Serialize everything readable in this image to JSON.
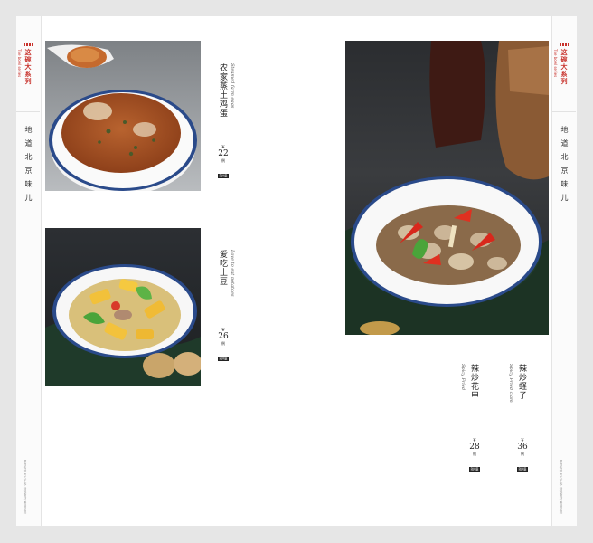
{
  "series": {
    "title": "这碗大系列",
    "subtitle": "The bowl series"
  },
  "region": "地道北京味儿",
  "footer": "源自传统 匠心之作 精选食材 美味呈现",
  "dishes": [
    {
      "cn": "农家蒸土鸡蛋",
      "en": "Steamed farm eggs",
      "currency": "¥",
      "price": "22",
      "unit": "例",
      "rmb": "RMB"
    },
    {
      "cn": "爱吃土豆",
      "en": "Love to eat potatoes",
      "currency": "¥",
      "price": "26",
      "unit": "例",
      "rmb": "RMB"
    },
    {
      "cn": "辣炒花甲",
      "en": "Spicy Fried",
      "currency": "¥",
      "price": "28",
      "unit": "例",
      "rmb": "RMB"
    },
    {
      "cn": "辣炒蛏子",
      "en": "Spicy Fried clam",
      "currency": "¥",
      "price": "36",
      "unit": "例",
      "rmb": "RMB"
    }
  ]
}
